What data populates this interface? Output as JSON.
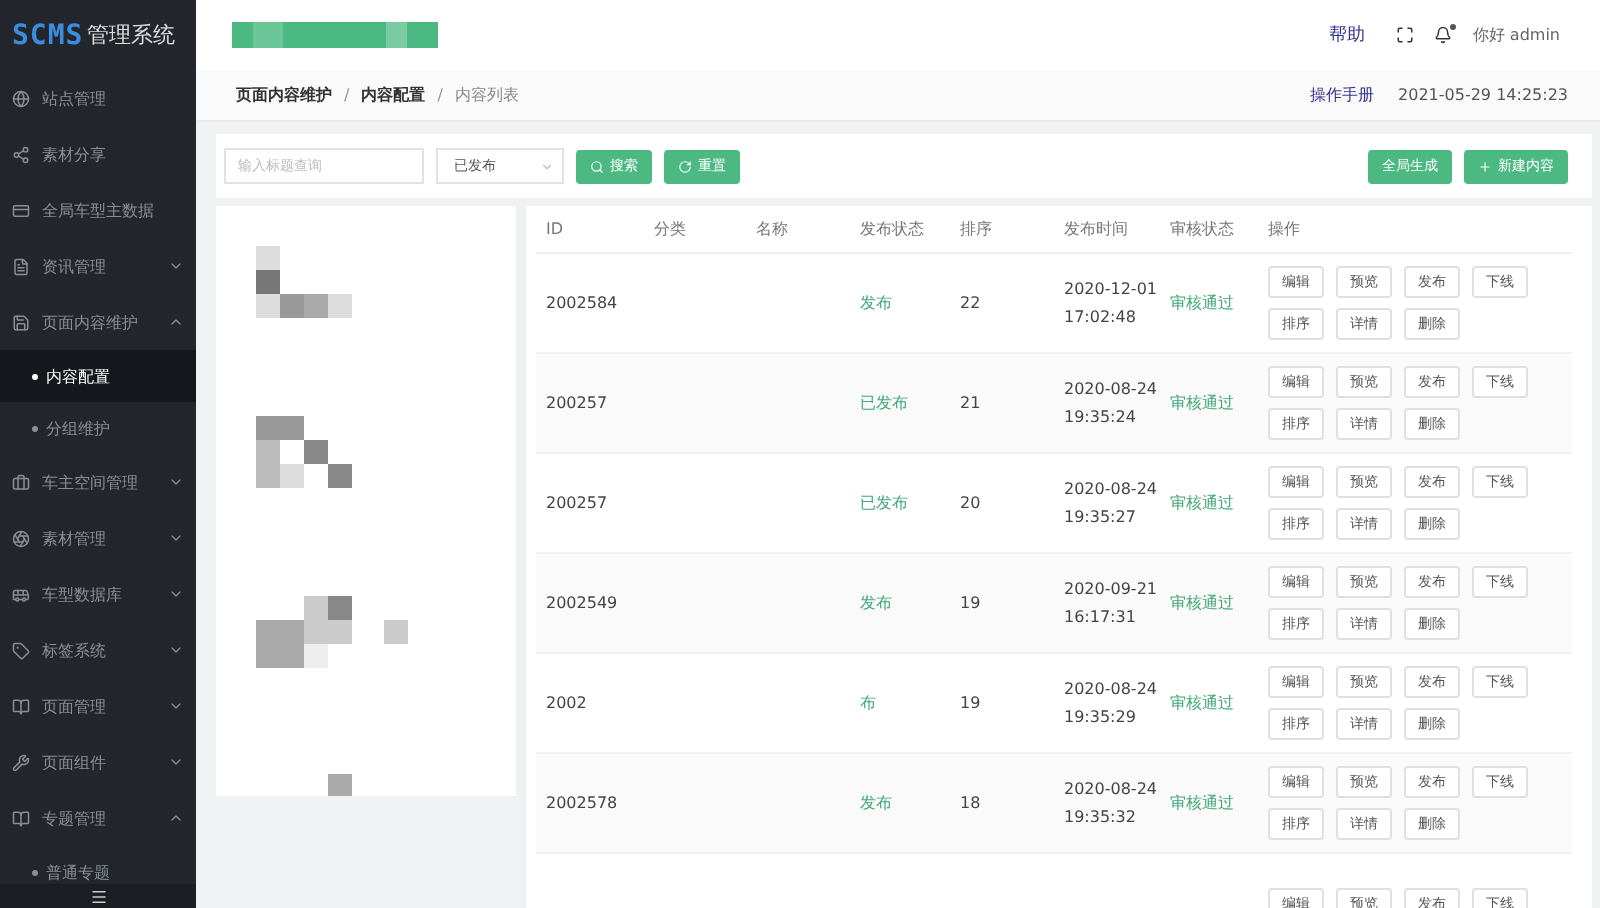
{
  "logo": {
    "mark": "SCMS",
    "title": "管理系统"
  },
  "sidebar": {
    "items": [
      {
        "label": "站点管理"
      },
      {
        "label": "素材分享"
      },
      {
        "label": "全局车型主数据"
      },
      {
        "label": "资讯管理",
        "expanded": false
      },
      {
        "label": "页面内容维护",
        "expanded": true,
        "children": [
          {
            "label": "内容配置",
            "selected": true
          },
          {
            "label": "分组维护",
            "selected": false
          }
        ]
      },
      {
        "label": "车主空间管理",
        "expanded": false
      },
      {
        "label": "素材管理",
        "expanded": false
      },
      {
        "label": "车型数据库",
        "expanded": false
      },
      {
        "label": "标签系统",
        "expanded": false
      },
      {
        "label": "页面管理",
        "expanded": false
      },
      {
        "label": "页面组件",
        "expanded": false
      },
      {
        "label": "专题管理",
        "expanded": true,
        "children": [
          {
            "label": "普通专题",
            "selected": false
          }
        ]
      }
    ]
  },
  "header": {
    "help": "帮助",
    "greeting": "你好",
    "user": "admin",
    "notification_dot": true
  },
  "breadcrumb": {
    "items": [
      "页面内容维护",
      "内容配置",
      "内容列表"
    ],
    "separators": [
      "/",
      "/"
    ],
    "manual": "操作手册",
    "datetime": "2021-05-29 14:25:23"
  },
  "filters": {
    "search": {
      "placeholder": "输入标题查询"
    },
    "status_select": {
      "value": "已发布"
    },
    "search_button": "搜索",
    "reset_button": "重置",
    "generate_button": "全局生成",
    "new_button": "新建内容"
  },
  "table": {
    "columns": [
      "ID",
      "分类",
      "名称",
      "发布状态",
      "排序",
      "发布时间",
      "审核状态",
      "操作"
    ],
    "rows": [
      {
        "id": "2002584",
        "status": "发布",
        "order": "22",
        "date": "2020-12-01",
        "time": "17:02:48",
        "review": "审核通过",
        "actions": [
          [
            "编辑",
            "预览",
            "发布",
            "下线"
          ],
          [
            "排序",
            "详情",
            "删除"
          ]
        ]
      },
      {
        "id": "200257",
        "status": "已发布",
        "order": "21",
        "date": "2020-08-24",
        "time": "19:35:24",
        "review": "审核通过",
        "actions": [
          [
            "编辑",
            "预览",
            "发布",
            "下线"
          ],
          [
            "排序",
            "详情",
            "删除"
          ]
        ]
      },
      {
        "id": "200257",
        "status": "已发布",
        "order": "20",
        "date": "2020-08-24",
        "time": "19:35:27",
        "review": "审核通过",
        "actions": [
          [
            "编辑",
            "预览",
            "发布",
            "下线"
          ],
          [
            "排序",
            "详情",
            "删除"
          ]
        ]
      },
      {
        "id": "2002549",
        "status": "发布",
        "order": "19",
        "date": "2020-09-21",
        "time": "16:17:31",
        "review": "审核通过",
        "actions": [
          [
            "编辑",
            "预览",
            "发布",
            "下线"
          ],
          [
            "排序",
            "详情",
            "删除"
          ]
        ]
      },
      {
        "id": "2002",
        "status": "布",
        "order": "19",
        "date": "2020-08-24",
        "time": "19:35:29",
        "review": "审核通过",
        "actions": [
          [
            "编辑",
            "预览",
            "发布",
            "下线"
          ],
          [
            "排序",
            "详情",
            "删除"
          ]
        ]
      },
      {
        "id": "2002578",
        "status": "发布",
        "order": "18",
        "date": "2020-08-24",
        "time": "19:35:32",
        "review": "审核通过",
        "actions": [
          [
            "编辑",
            "预览",
            "发布",
            "下线"
          ],
          [
            "排序",
            "详情",
            "删除"
          ]
        ]
      },
      {
        "actions": [
          [
            "编辑",
            "预览",
            "发布",
            "下线"
          ]
        ]
      }
    ]
  }
}
